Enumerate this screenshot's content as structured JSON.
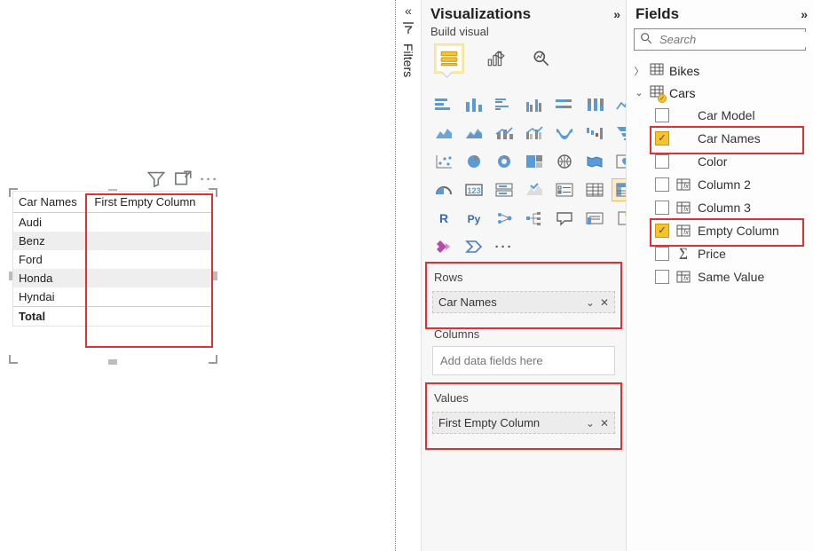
{
  "filters": {
    "label": "Filters"
  },
  "viz": {
    "title": "Visualizations",
    "build_label": "Build visual",
    "wells": {
      "rows_label": "Rows",
      "rows_chip": "Car Names",
      "columns_label": "Columns",
      "columns_placeholder": "Add data fields here",
      "values_label": "Values",
      "values_chip": "First Empty Column"
    }
  },
  "fields": {
    "title": "Fields",
    "search_placeholder": "Search",
    "tables": [
      {
        "name": "Bikes",
        "expanded": false
      },
      {
        "name": "Cars",
        "expanded": true
      }
    ],
    "cars_fields": [
      {
        "label": "Car Model",
        "checked": false,
        "icon": "none"
      },
      {
        "label": "Car Names",
        "checked": true,
        "icon": "none"
      },
      {
        "label": "Color",
        "checked": false,
        "icon": "none"
      },
      {
        "label": "Column 2",
        "checked": false,
        "icon": "fx"
      },
      {
        "label": "Column 3",
        "checked": false,
        "icon": "fx"
      },
      {
        "label": "Empty Column",
        "checked": true,
        "icon": "fx"
      },
      {
        "label": "Price",
        "checked": false,
        "icon": "sigma"
      },
      {
        "label": "Same Value",
        "checked": false,
        "icon": "fx"
      }
    ]
  },
  "visual": {
    "col1": "Car Names",
    "col2": "First Empty Column",
    "rows": [
      "Audi",
      "Benz",
      "Ford",
      "Honda",
      "Hyndai"
    ],
    "total_label": "Total"
  }
}
